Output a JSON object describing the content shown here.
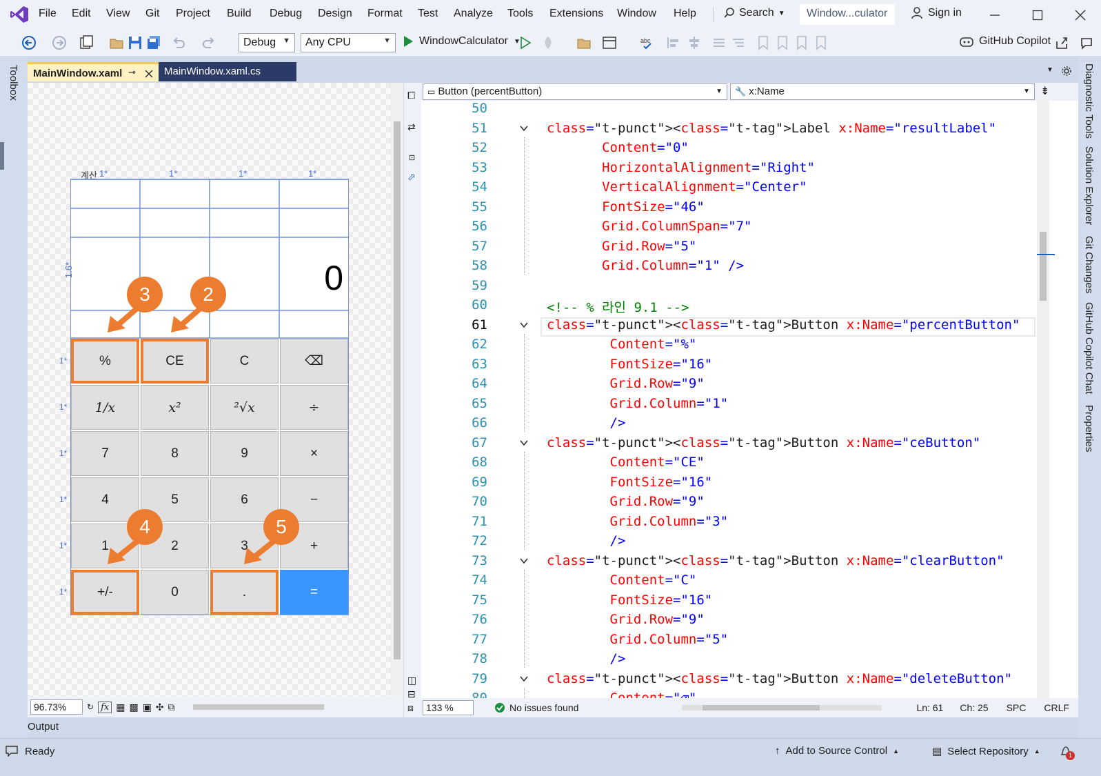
{
  "menu": [
    "File",
    "Edit",
    "View",
    "Git",
    "Project",
    "Build",
    "Debug",
    "Design",
    "Format",
    "Test",
    "Analyze",
    "Tools",
    "Extensions",
    "Window",
    "Help"
  ],
  "search": "Search",
  "window_title": "Window...culator",
  "sign_in": "Sign in",
  "toolbar": {
    "config": "Debug",
    "platform": "Any CPU",
    "run_target": "WindowCalculator",
    "copilot": "GitHub Copilot"
  },
  "toolbox": "Toolbox",
  "right_panels": [
    "Diagnostic Tools",
    "Solution Explorer",
    "Git Changes",
    "GitHub Copilot Chat",
    "Properties"
  ],
  "tabs": [
    {
      "label": "MainWindow.xaml",
      "active": true
    },
    {
      "label": "MainWindow.xaml.cs",
      "active": false
    }
  ],
  "designer": {
    "window_title": "계산",
    "col_markers": [
      "1*",
      "1*",
      "1*",
      "1*"
    ],
    "row_markers": [
      "1.6*",
      "1*",
      "1*",
      "1*",
      "1*",
      "1*",
      "1*"
    ],
    "result": "0",
    "buttons": [
      [
        "%",
        "CE",
        "C",
        "⌫"
      ],
      [
        "1/x",
        "x²",
        "²√x",
        "÷"
      ],
      [
        "7",
        "8",
        "9",
        "×"
      ],
      [
        "4",
        "5",
        "6",
        "−"
      ],
      [
        "1",
        "2",
        "3",
        "+"
      ],
      [
        "+/-",
        "0",
        ".",
        "="
      ]
    ],
    "badges": [
      "3",
      "2",
      "4",
      "5"
    ],
    "zoom": "96.73%"
  },
  "editor": {
    "element_combo": "Button (percentButton)",
    "member_combo": "x:Name",
    "zoom": "133 %",
    "issues": "No issues found",
    "ln": "Ln: 61",
    "ch": "Ch: 25",
    "spc": "SPC",
    "crlf": "CRLF",
    "current_line": 61,
    "lines": [
      {
        "n": "50",
        "t": ""
      },
      {
        "n": "51",
        "t": "<Label x:Name=\"resultLabel\""
      },
      {
        "n": "52",
        "t": "       Content=\"0\""
      },
      {
        "n": "53",
        "t": "       HorizontalAlignment=\"Right\""
      },
      {
        "n": "54",
        "t": "       VerticalAlignment=\"Center\""
      },
      {
        "n": "55",
        "t": "       FontSize=\"46\""
      },
      {
        "n": "56",
        "t": "       Grid.ColumnSpan=\"7\""
      },
      {
        "n": "57",
        "t": "       Grid.Row=\"5\""
      },
      {
        "n": "58",
        "t": "       Grid.Column=\"1\" />"
      },
      {
        "n": "59",
        "t": ""
      },
      {
        "n": "60",
        "t": "<!-- % 라인 9.1 -->"
      },
      {
        "n": "61",
        "t": "<Button x:Name=\"percentButton\""
      },
      {
        "n": "62",
        "t": "        Content=\"%\""
      },
      {
        "n": "63",
        "t": "        FontSize=\"16\""
      },
      {
        "n": "64",
        "t": "        Grid.Row=\"9\""
      },
      {
        "n": "65",
        "t": "        Grid.Column=\"1\""
      },
      {
        "n": "66",
        "t": "        />"
      },
      {
        "n": "67",
        "t": "<Button x:Name=\"ceButton\""
      },
      {
        "n": "68",
        "t": "        Content=\"CE\""
      },
      {
        "n": "69",
        "t": "        FontSize=\"16\""
      },
      {
        "n": "70",
        "t": "        Grid.Row=\"9\""
      },
      {
        "n": "71",
        "t": "        Grid.Column=\"3\""
      },
      {
        "n": "72",
        "t": "        />"
      },
      {
        "n": "73",
        "t": "<Button x:Name=\"clearButton\""
      },
      {
        "n": "74",
        "t": "        Content=\"C\""
      },
      {
        "n": "75",
        "t": "        FontSize=\"16\""
      },
      {
        "n": "76",
        "t": "        Grid.Row=\"9\""
      },
      {
        "n": "77",
        "t": "        Grid.Column=\"5\""
      },
      {
        "n": "78",
        "t": "        />"
      },
      {
        "n": "79",
        "t": "<Button x:Name=\"deleteButton\""
      },
      {
        "n": "80",
        "t": "        Content=\"⌫\""
      }
    ]
  },
  "output": "Output",
  "status": {
    "ready": "Ready",
    "add_source": "Add to Source Control",
    "select_repo": "Select Repository",
    "notif_count": "1"
  },
  "colors": {
    "accent_orange": "#ec7c30",
    "vs_purple": "#6c3bbf",
    "equals_blue": "#3a96ff",
    "run_green": "#1e8e3e"
  }
}
